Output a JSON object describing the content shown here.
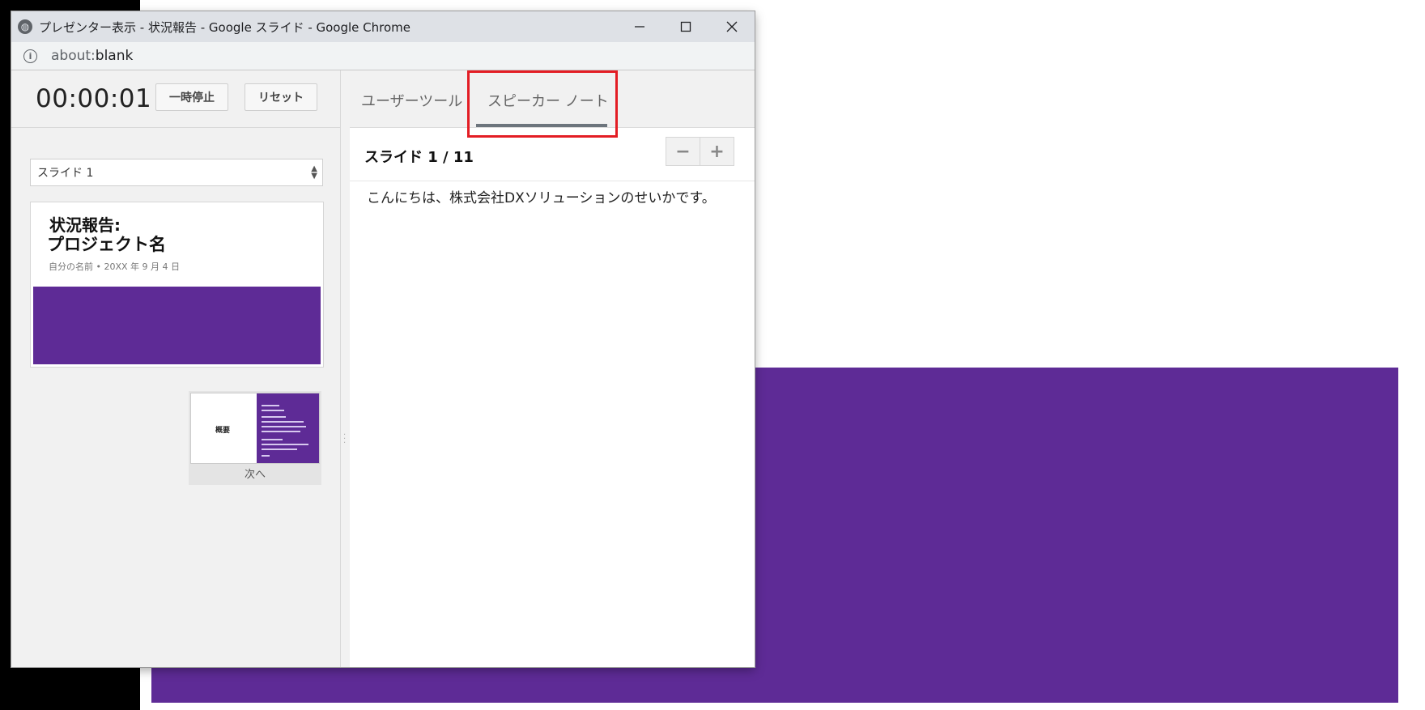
{
  "window": {
    "title": "プレゼンター表示 - 状況報告 - Google スライド - Google Chrome",
    "controls": {
      "minimize": "—",
      "maximize": "☐",
      "close": "✕"
    }
  },
  "address_bar": {
    "scheme": "about:",
    "rest": "blank"
  },
  "timer": {
    "value": "00:00:01",
    "pause_label": "一時停止",
    "reset_label": "リセット"
  },
  "slide_select": {
    "value": "スライド 1"
  },
  "current_slide": {
    "title_line1": "状況報告:",
    "title_line2": "プロジェクト名",
    "subtitle": "自分の名前 • 20XX 年 9 月 4 日",
    "accent_color": "#5e2b96"
  },
  "next_slide": {
    "thumb_title": "概要",
    "label": "次へ"
  },
  "tabs": [
    {
      "label": "ユーザーツール"
    },
    {
      "label": "スピーカー ノート",
      "active": true
    }
  ],
  "notes": {
    "slide_counter": "スライド 1 / 11",
    "zoom_out": "−",
    "zoom_in": "+",
    "text": "こんにちは、株式会社DXソリューションのせいかです。"
  },
  "colors": {
    "brand_purple": "#5e2b96",
    "highlight_red": "#e31d24"
  },
  "icons": [
    "globe-icon",
    "info-icon",
    "minimize-icon",
    "maximize-icon",
    "close-icon",
    "select-arrows-icon"
  ]
}
